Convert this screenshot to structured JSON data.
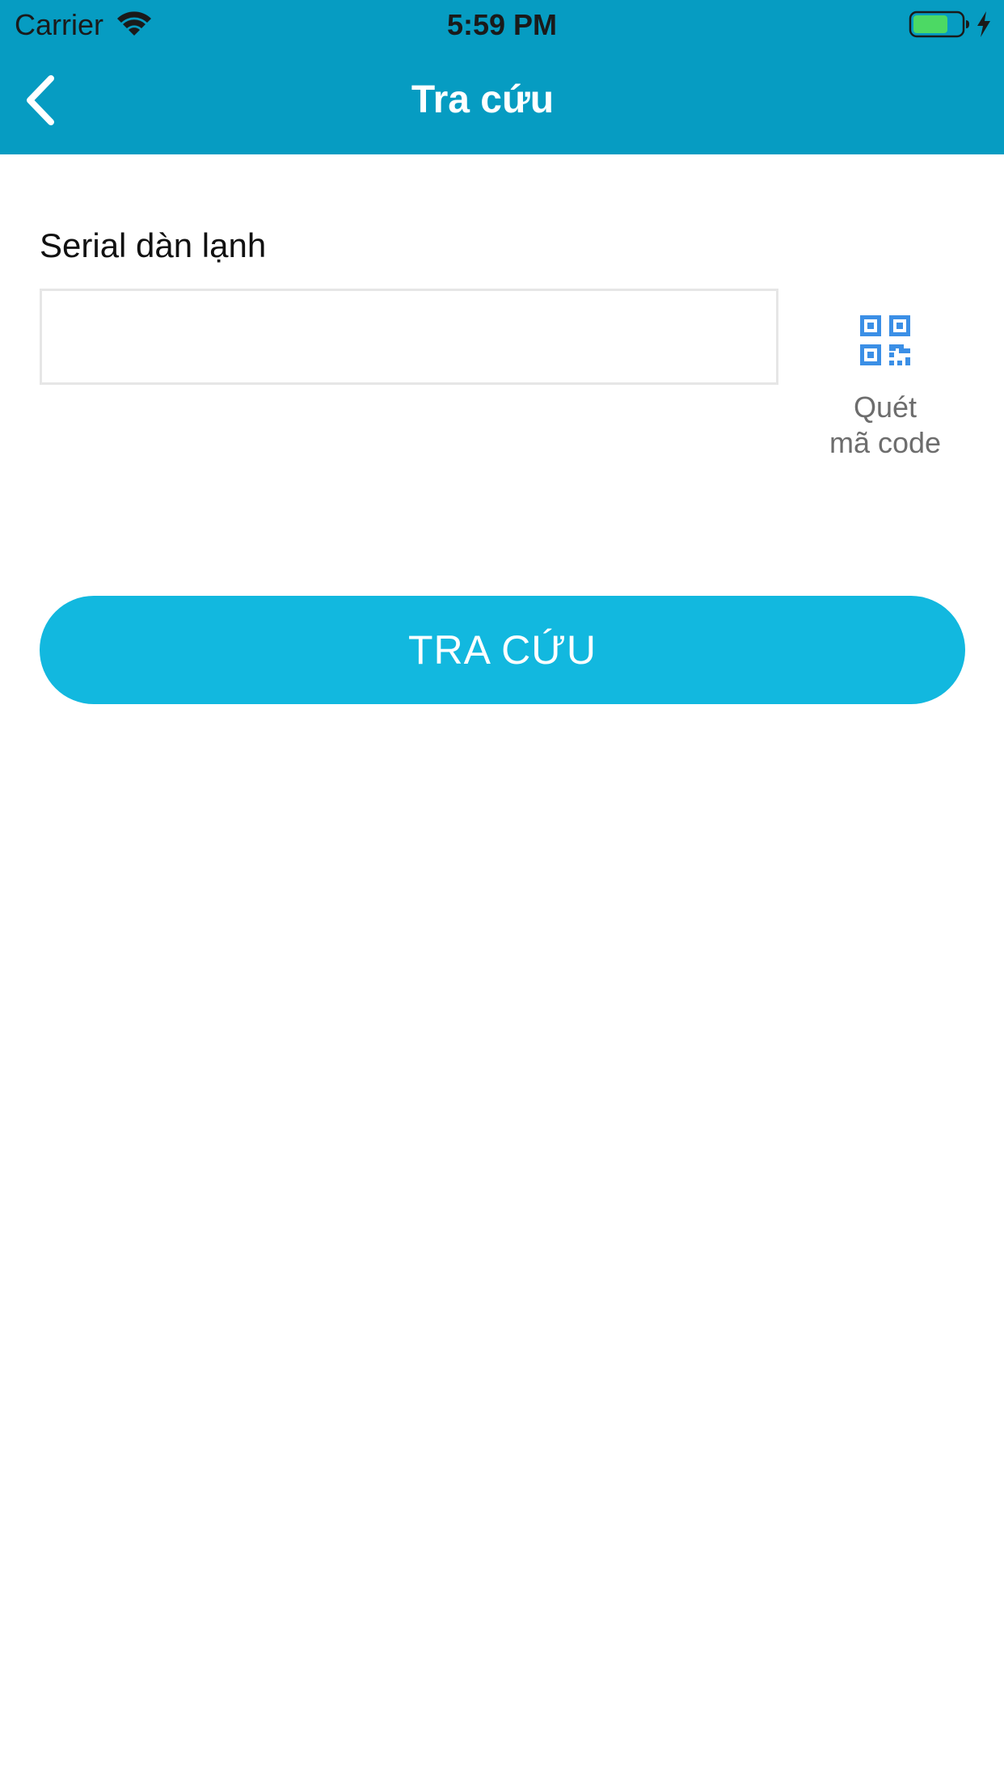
{
  "status_bar": {
    "carrier": "Carrier",
    "time": "5:59 PM",
    "wifi_icon": "wifi-icon",
    "battery_icon": "battery-icon",
    "charge_icon": "lightning-icon"
  },
  "nav": {
    "back_icon": "chevron-left-icon",
    "title": "Tra cứu"
  },
  "form": {
    "serial_label": "Serial dàn lạnh",
    "serial_value": "",
    "serial_placeholder": "",
    "qr_icon": "qr-code-icon",
    "qr_label": "Quét\nmã code",
    "submit_label": "TRA CỨU"
  },
  "colors": {
    "header_bg": "#069cc2",
    "button_bg": "#12b8df",
    "qr_icon": "#3b8fe6",
    "battery_fill": "#4cd964"
  }
}
